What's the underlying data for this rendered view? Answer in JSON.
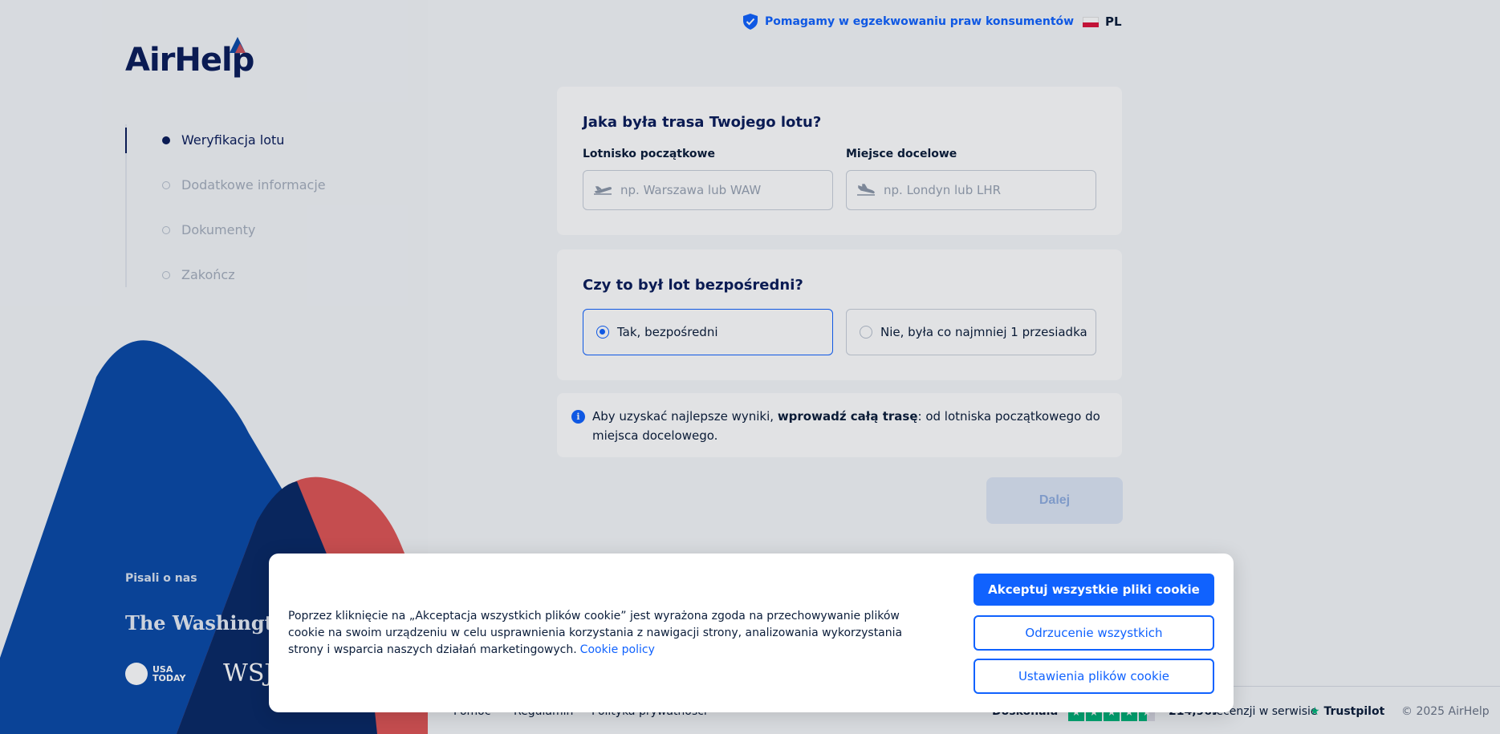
{
  "brand": {
    "name": "AirHelp"
  },
  "header": {
    "claim": "Pomagamy w egzekwowaniu praw konsumentów",
    "claim_icon": "shield-check-icon",
    "language": "PL"
  },
  "steps": [
    {
      "label": "Weryfikacja lotu",
      "active": true
    },
    {
      "label": "Dodatkowe informacje",
      "active": false
    },
    {
      "label": "Dokumenty",
      "active": false
    },
    {
      "label": "Zakończ",
      "active": false
    }
  ],
  "press": {
    "title": "Pisali o nas",
    "outlets": [
      "The Washington Post",
      "USA TODAY",
      "WSJ"
    ]
  },
  "route": {
    "title": "Jaka była trasa Twojego lotu?",
    "origin_label": "Lotnisko początkowe",
    "origin_placeholder": "np. Warszawa lub WAW",
    "origin_value": "",
    "destination_label": "Miejsce docelowe",
    "destination_placeholder": "np. Londyn lub LHR",
    "destination_value": ""
  },
  "direct": {
    "title": "Czy to był lot bezpośredni?",
    "options": [
      {
        "label": "Tak, bezpośredni",
        "selected": true
      },
      {
        "label": "Nie, była co najmniej 1 przesiadka",
        "selected": false
      }
    ]
  },
  "info": {
    "prefix": "Aby uzyskać najlepsze wyniki, ",
    "bold": "wprowadź całą trasę",
    "suffix": ": od lotniska początkowego do miejsca docelowego."
  },
  "next_button": "Dalej",
  "footer": {
    "links": [
      "Pomoc",
      "Regulamin",
      "Polityka prywatności"
    ],
    "rating_label": "Doskonała",
    "review_count": "214,967",
    "review_text": "recenzji w serwisie",
    "trustpilot": "Trustpilot",
    "copyright": "© 2025 AirHelp"
  },
  "cookie": {
    "text": "Poprzez kliknięcie na „Akceptacja wszystkich plików cookie” jest wyrażona zgoda na przechowywanie plików cookie na swoim urządzeniu w celu usprawnienia korzystania z nawigacji strony, analizowania wykorzystania strony i wsparcia naszych działań marketingowych.",
    "policy_link": "Cookie policy",
    "accept_all": "Akceptuj wszystkie pliki cookie",
    "reject_all": "Odrzucenie wszystkich",
    "settings": "Ustawienia plików cookie"
  },
  "colors": {
    "accent": "#1062fe",
    "navy": "#0b1d5b",
    "brand_blue": "#0b4aa8",
    "brand_red": "#e05656",
    "trustpilot_green": "#00b67a"
  }
}
